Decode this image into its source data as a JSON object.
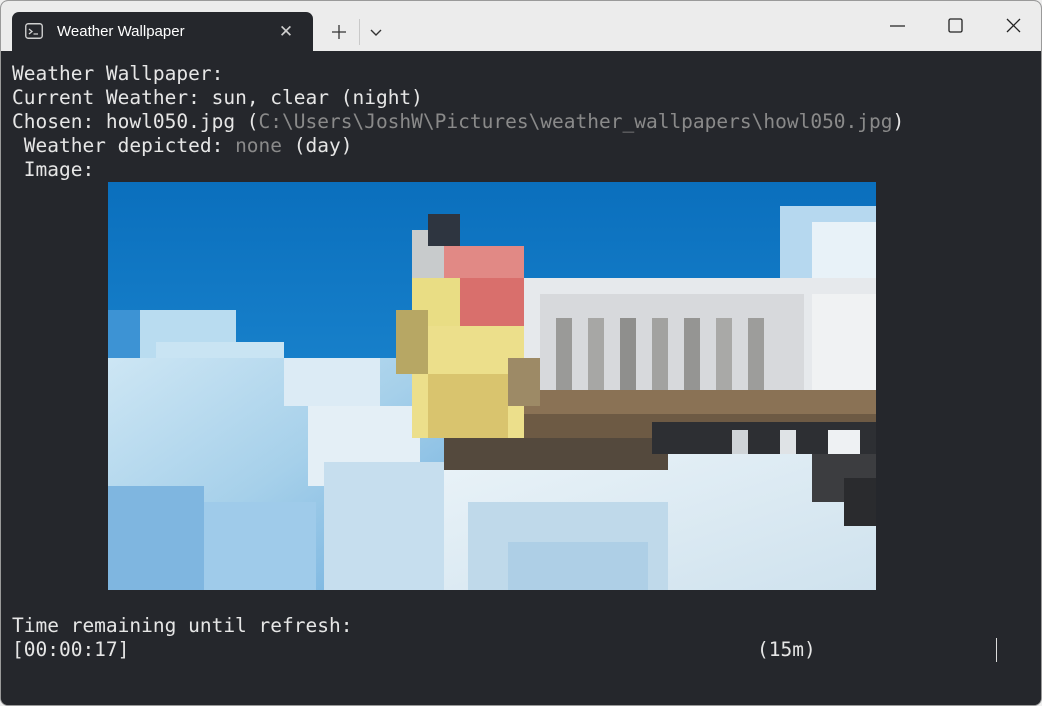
{
  "window": {
    "tab_title": "Weather Wallpaper",
    "tab_icon": "terminal-icon",
    "new_tab_icon": "plus-icon",
    "dropdown_icon": "chevron-down-icon",
    "controls": [
      "minimize-icon",
      "maximize-icon",
      "close-icon"
    ]
  },
  "terminal": {
    "heading": "Weather Wallpaper:",
    "current_weather_label": "Current Weather: ",
    "current_weather_value": "sun, clear (night)",
    "chosen_label": "Chosen: ",
    "chosen_file": "howl050.jpg",
    "chosen_open_paren": " (",
    "chosen_path": "C:\\Users\\JoshW\\Pictures\\weather_wallpapers\\howl050.jpg",
    "chosen_close_paren": ")",
    "weather_depicted_label": " Weather depicted: ",
    "weather_depicted_value": "none",
    "weather_depicted_time": " (day)",
    "image_label": " Image:",
    "refresh_label": "Time remaining until refresh:",
    "timer": "[00:00:17]",
    "interval": "(15m)"
  },
  "colors": {
    "terminal_background": "#25272c",
    "terminal_text": "#e6e6e6",
    "dim_text": "#8a8a8a",
    "titlebar_background": "#ececec"
  }
}
